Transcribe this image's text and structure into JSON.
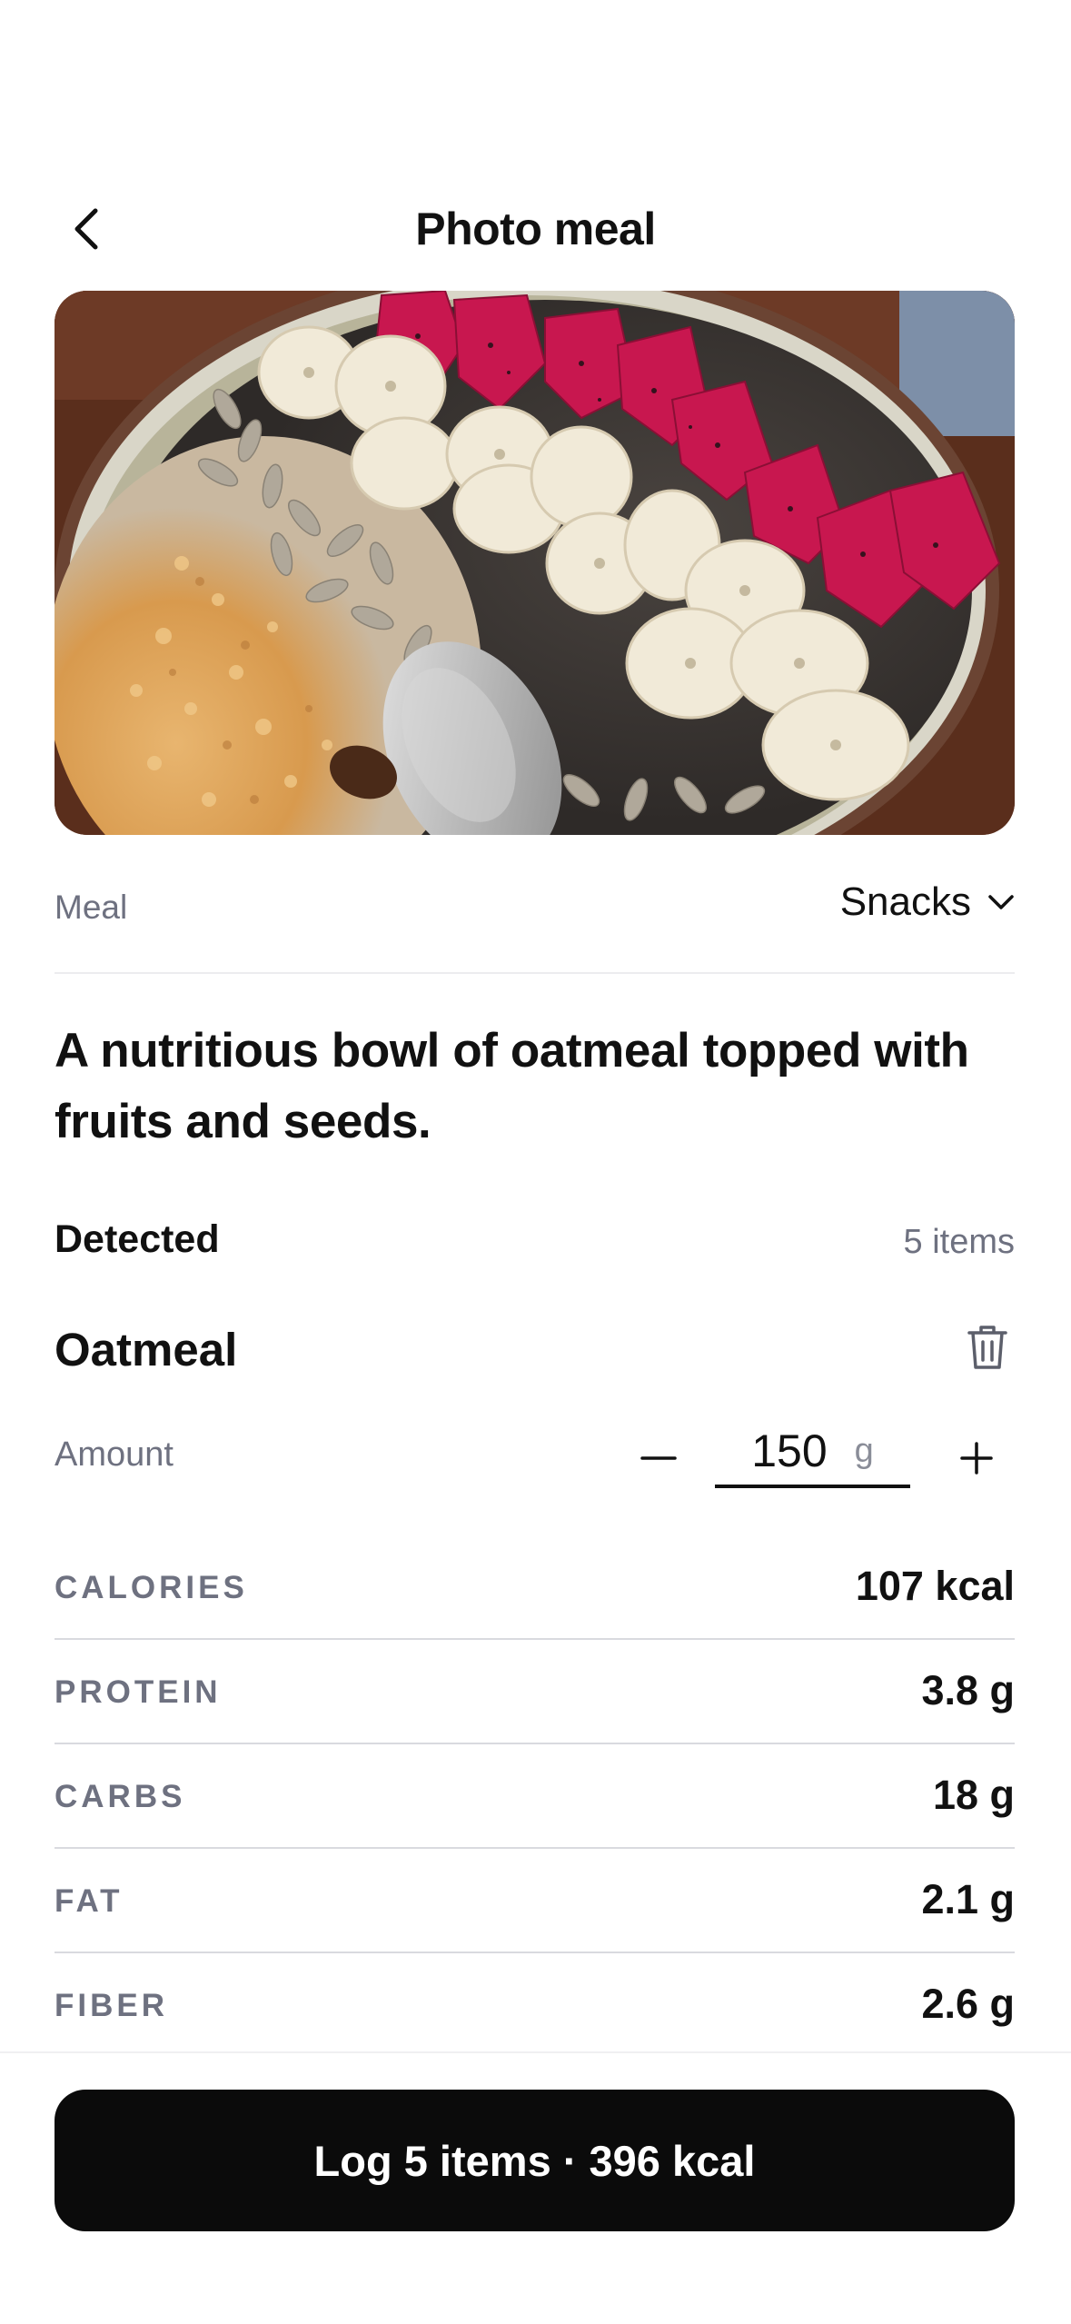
{
  "header": {
    "title": "Photo meal",
    "back_icon": "chevron-left-icon"
  },
  "photo": {
    "subject": "oatmeal bowl with banana, dragon fruit, sunflower seeds and chia"
  },
  "meal": {
    "label": "Meal",
    "value": "Snacks",
    "icon": "chevron-down-icon"
  },
  "description": "A nutritious bowl of oatmeal topped with fruits and seeds.",
  "detected": {
    "label": "Detected",
    "count": "5 items"
  },
  "item": {
    "name": "Oatmeal",
    "delete_icon": "trash-icon",
    "amount_label": "Amount",
    "amount_value": "150",
    "amount_unit": "g",
    "minus_icon": "minus-icon",
    "plus_icon": "plus-icon"
  },
  "nutrients": [
    {
      "name": "CALORIES",
      "value": "107 kcal"
    },
    {
      "name": "PROTEIN",
      "value": "3.8 g"
    },
    {
      "name": "CARBS",
      "value": "18 g"
    },
    {
      "name": "FAT",
      "value": "2.1 g"
    },
    {
      "name": "FIBER",
      "value": "2.6 g"
    }
  ],
  "action": {
    "log_label": "Log 5 items · 396 kcal"
  },
  "colors": {
    "primary_text": "#111111",
    "secondary_text": "#6e7180",
    "button_bg": "#0b0b0b",
    "button_text": "#ffffff"
  }
}
